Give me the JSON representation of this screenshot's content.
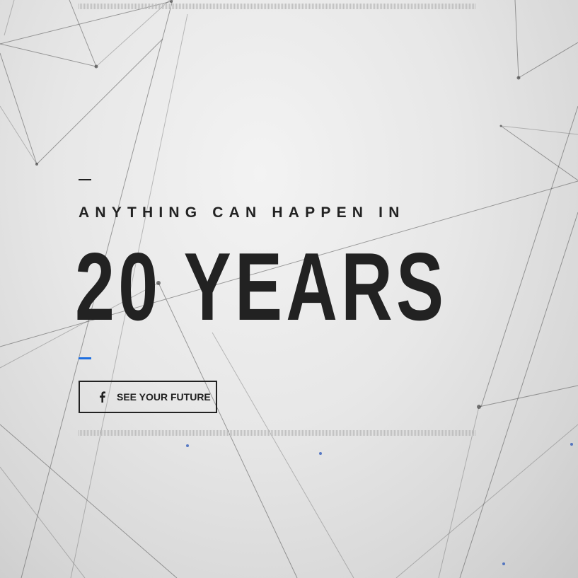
{
  "hero": {
    "tagline": "ANYTHING CAN HAPPEN IN",
    "headline": "20 YEARS",
    "cta": {
      "label": "SEE YOUR FUTURE",
      "icon": "facebook-icon"
    }
  },
  "colors": {
    "text": "#222222",
    "accent_blue": "#1f6fe0",
    "background": "#e7e7e7"
  }
}
